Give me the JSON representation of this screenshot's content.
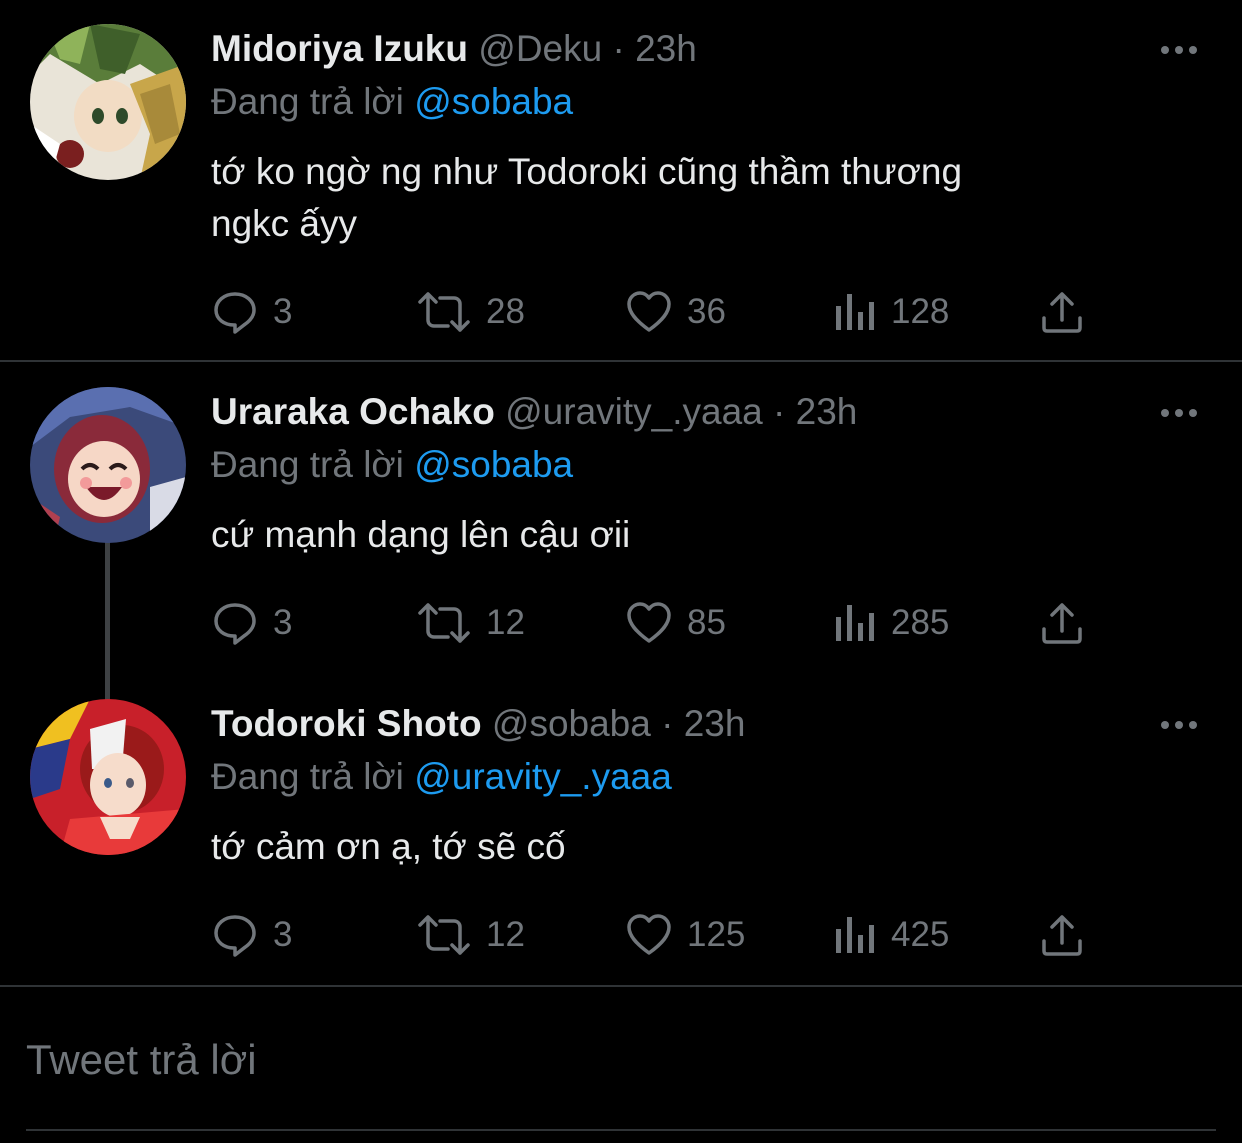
{
  "tweets": [
    {
      "name": "Midoriya Izuku",
      "handle": "@Deku",
      "separator": "·",
      "time": "23h",
      "replying_prefix": "Đang trả lời",
      "replying_to": "@sobaba",
      "text_line1": "tớ ko ngờ ng như Todoroki cũng thầm thương",
      "text_line2": "ngkc ấyy",
      "replies": "3",
      "retweets": "28",
      "likes": "36",
      "views": "128"
    },
    {
      "name": "Uraraka Ochako",
      "handle": "@uravity_.yaaa",
      "separator": "·",
      "time": "23h",
      "replying_prefix": "Đang trả lời",
      "replying_to": "@sobaba",
      "text_line1": "cứ mạnh dạng lên cậu ơii",
      "replies": "3",
      "retweets": "12",
      "likes": "85",
      "views": "285"
    },
    {
      "name": "Todoroki Shoto",
      "handle": "@sobaba",
      "separator": "·",
      "time": "23h",
      "replying_prefix": "Đang trả lời",
      "replying_to": "@uravity_.yaaa",
      "text_line1": "tớ cảm ơn ạ, tớ sẽ cố",
      "replies": "3",
      "retweets": "12",
      "likes": "125",
      "views": "425"
    }
  ],
  "reply_box": {
    "placeholder": "Tweet trả lời"
  },
  "icons": {
    "reply": "reply-icon",
    "retweet": "retweet-icon",
    "like": "heart-icon",
    "views": "views-icon",
    "share": "share-icon",
    "more": "more-icon"
  },
  "colors": {
    "background": "#000000",
    "text": "#e7e9ea",
    "secondary": "#71767b",
    "accent": "#1d9bf0",
    "divider": "#2f3336"
  }
}
